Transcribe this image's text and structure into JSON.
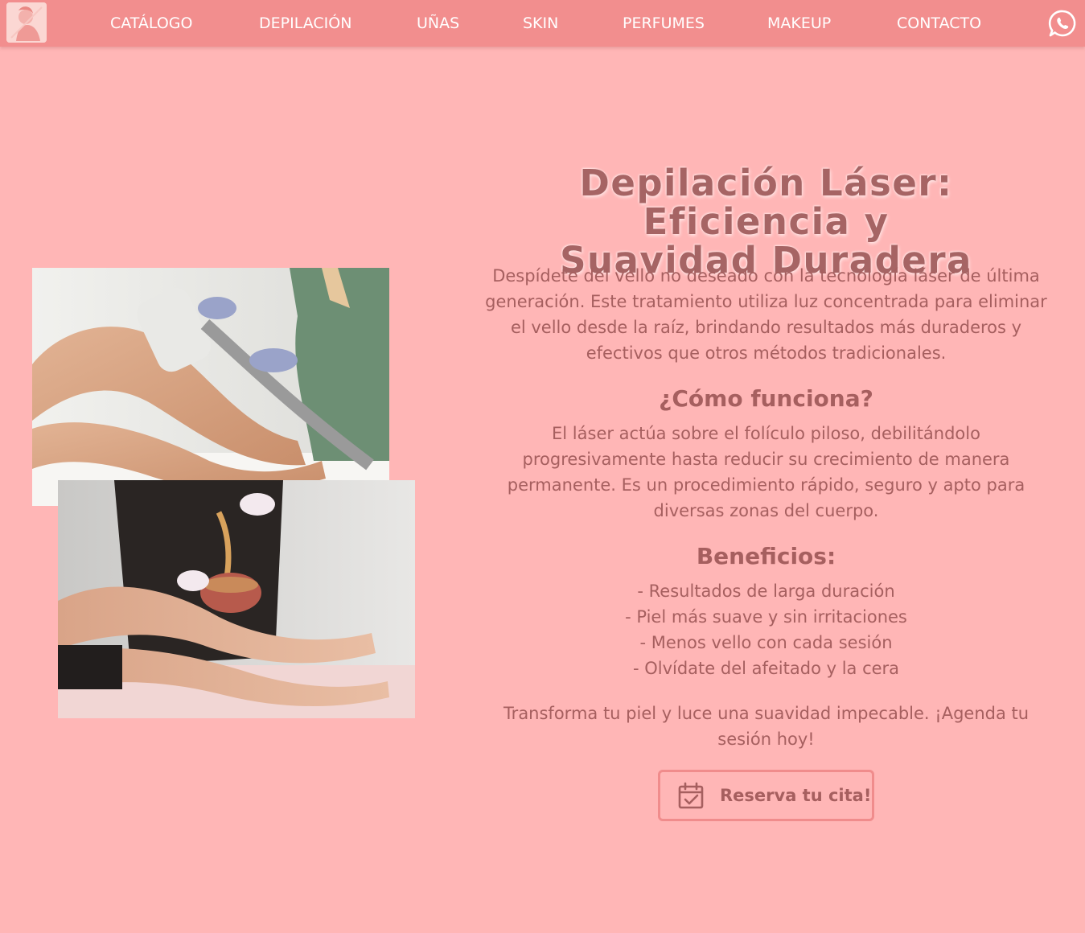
{
  "nav": {
    "logo_icon": "salon-logo-icon",
    "items": [
      {
        "label": "CATÁLOGO"
      },
      {
        "label": "DEPILACIÓN"
      },
      {
        "label": "UÑAS"
      },
      {
        "label": "SKIN"
      },
      {
        "label": "PERFUMES"
      },
      {
        "label": "MAKEUP"
      },
      {
        "label": "CONTACTO"
      }
    ],
    "whatsapp_icon": "whatsapp-icon"
  },
  "colors": {
    "background": "#ffb6b6",
    "navbar": "#f28e8e",
    "text": "#a65f5f",
    "button_border": "#f08c8c"
  },
  "main": {
    "title_line1": "Depilación Láser: Eficiencia y",
    "title_line2": "Suavidad Duradera",
    "intro_lines": [
      "Despídete del vello no deseado con la tecnología láser de última",
      "generación. Este tratamiento utiliza luz concentrada para eliminar",
      "el vello desde la raíz, brindando resultados más duraderos y",
      "efectivos que otros métodos tradicionales."
    ],
    "how_title": "¿Cómo funciona?",
    "how_lines": [
      "El láser actúa sobre el folículo piloso, debilitándolo",
      "progresivamente hasta reducir su crecimiento de manera",
      "permanente. Es un procedimiento rápido, seguro y apto para",
      "diversas zonas del cuerpo."
    ],
    "benefits_title": "Beneficios:",
    "benefits": [
      "- Resultados de larga duración",
      "- Piel más suave y sin irritaciones",
      "- Menos vello con cada sesión",
      "- Olvídate del afeitado y la cera"
    ],
    "cta_lines": [
      "Transforma tu piel y luce una suavidad impecable. ¡Agenda tu",
      "sesión hoy!"
    ],
    "reserve_label": "Reserva tu cita!",
    "reserve_icon": "calendar-check-icon"
  },
  "images": [
    {
      "name": "laser-treatment-photo",
      "subject": "laser hair removal on leg"
    },
    {
      "name": "waxing-treatment-photo",
      "subject": "wax hair removal on legs"
    }
  ]
}
